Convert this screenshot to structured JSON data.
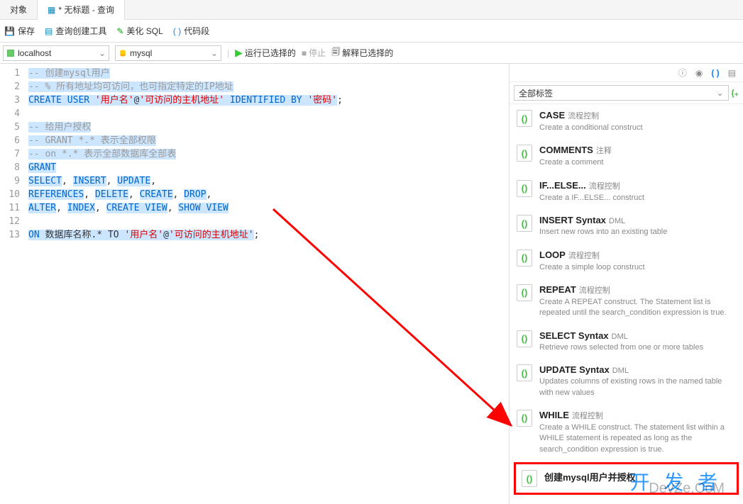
{
  "tabs": {
    "objects": "对象",
    "query": "* 无标题 - 查询"
  },
  "toolbar": {
    "save": "保存",
    "query_builder": "查询创建工具",
    "beautify": "美化 SQL",
    "code_snippet": "代码段"
  },
  "connections": {
    "host": "localhost",
    "db": "mysql"
  },
  "runbar": {
    "run_selected": "运行已选择的",
    "stop": "停止",
    "explain_selected": "解释已选择的"
  },
  "code": {
    "lines": [
      {
        "n": 1,
        "seg": [
          {
            "t": "-- 创建mysql用户",
            "c": "comment",
            "hl": true
          }
        ]
      },
      {
        "n": 2,
        "seg": [
          {
            "t": "-- % 所有地址均可访问，也可指定特定的IP地址",
            "c": "comment",
            "hl": true
          }
        ]
      },
      {
        "n": 3,
        "seg": [
          {
            "t": "CREATE USER ",
            "c": "kw",
            "hl": true
          },
          {
            "t": "'用户名'",
            "c": "str",
            "hl": true
          },
          {
            "t": "@",
            "c": "op",
            "hl": true
          },
          {
            "t": "'可访问的主机地址'",
            "c": "str",
            "hl": true
          },
          {
            "t": " IDENTIFIED BY ",
            "c": "kw",
            "hl": true
          },
          {
            "t": "'密码'",
            "c": "str",
            "hl": true
          },
          {
            "t": ";",
            "c": "op",
            "hl": false
          }
        ]
      },
      {
        "n": 4,
        "seg": []
      },
      {
        "n": 5,
        "seg": [
          {
            "t": "-- 给用户授权",
            "c": "comment",
            "hl": true
          }
        ]
      },
      {
        "n": 6,
        "seg": [
          {
            "t": "-- GRANT *.* 表示全部权限",
            "c": "comment",
            "hl": true
          }
        ]
      },
      {
        "n": 7,
        "seg": [
          {
            "t": "-- on *.* 表示全部数据库全部表",
            "c": "comment",
            "hl": true
          }
        ]
      },
      {
        "n": 8,
        "seg": [
          {
            "t": "GRANT",
            "c": "kw",
            "hl": true
          }
        ]
      },
      {
        "n": 9,
        "seg": [
          {
            "t": "SELECT",
            "c": "kw",
            "hl": true
          },
          {
            "t": ", ",
            "c": "op",
            "hl": false
          },
          {
            "t": "INSERT",
            "c": "kw",
            "hl": true
          },
          {
            "t": ", ",
            "c": "op",
            "hl": false
          },
          {
            "t": "UPDATE",
            "c": "kw",
            "hl": true
          },
          {
            "t": ",",
            "c": "op",
            "hl": false
          }
        ]
      },
      {
        "n": 10,
        "seg": [
          {
            "t": "REFERENCES",
            "c": "kw",
            "hl": true
          },
          {
            "t": ", ",
            "c": "op",
            "hl": false
          },
          {
            "t": "DELETE",
            "c": "kw",
            "hl": true
          },
          {
            "t": ", ",
            "c": "op",
            "hl": false
          },
          {
            "t": "CREATE",
            "c": "kw",
            "hl": true
          },
          {
            "t": ", ",
            "c": "op",
            "hl": false
          },
          {
            "t": "DROP",
            "c": "kw",
            "hl": true
          },
          {
            "t": ",",
            "c": "op",
            "hl": false
          }
        ]
      },
      {
        "n": 11,
        "seg": [
          {
            "t": "ALTER",
            "c": "kw",
            "hl": true
          },
          {
            "t": ", ",
            "c": "op",
            "hl": false
          },
          {
            "t": "INDEX",
            "c": "kw",
            "hl": true
          },
          {
            "t": ", ",
            "c": "op",
            "hl": false
          },
          {
            "t": "CREATE VIEW",
            "c": "kw",
            "hl": true
          },
          {
            "t": ", ",
            "c": "op",
            "hl": false
          },
          {
            "t": "SHOW VIEW",
            "c": "kw",
            "hl": true
          }
        ]
      },
      {
        "n": 12,
        "seg": []
      },
      {
        "n": 13,
        "seg": [
          {
            "t": "ON",
            "c": "kw",
            "hl": true
          },
          {
            "t": " 数据库名称.* TO ",
            "c": "op",
            "hl": true
          },
          {
            "t": "'用户名'",
            "c": "str",
            "hl": true
          },
          {
            "t": "@",
            "c": "op",
            "hl": true
          },
          {
            "t": "'可访问的主机地址'",
            "c": "str",
            "hl": true
          },
          {
            "t": ";",
            "c": "op",
            "hl": false
          }
        ]
      }
    ]
  },
  "side": {
    "tag_label": "全部标签",
    "snippets": [
      {
        "title": "CASE",
        "sub": "流程控制",
        "desc": "Create a conditional construct"
      },
      {
        "title": "COMMENTS",
        "sub": "注释",
        "desc": "Create a comment"
      },
      {
        "title": "IF...ELSE...",
        "sub": "流程控制",
        "desc": "Create a IF...ELSE... construct"
      },
      {
        "title": "INSERT Syntax",
        "sub": "DML",
        "desc": "Insert new rows into an existing table"
      },
      {
        "title": "LOOP",
        "sub": "流程控制",
        "desc": "Create a simple loop construct"
      },
      {
        "title": "REPEAT",
        "sub": "流程控制",
        "desc": "Create A REPEAT construct. The Statement list is repeated until the search_condition expression is true."
      },
      {
        "title": "SELECT Syntax",
        "sub": "DML",
        "desc": "Retrieve rows selected from one or more tables"
      },
      {
        "title": "UPDATE Syntax",
        "sub": "DML",
        "desc": "Updates columns of existing rows in the named table with new values"
      },
      {
        "title": "WHILE",
        "sub": "流程控制",
        "desc": "Create a WHILE construct. The statement list within a WHILE statement is repeated as long as the search_condition expression is true."
      },
      {
        "title": "创建mysql用户并授权",
        "sub": "",
        "desc": "",
        "highlighted": true
      }
    ]
  },
  "watermark": {
    "main": "开 发 者",
    "sub": "DevZe.CoM"
  }
}
